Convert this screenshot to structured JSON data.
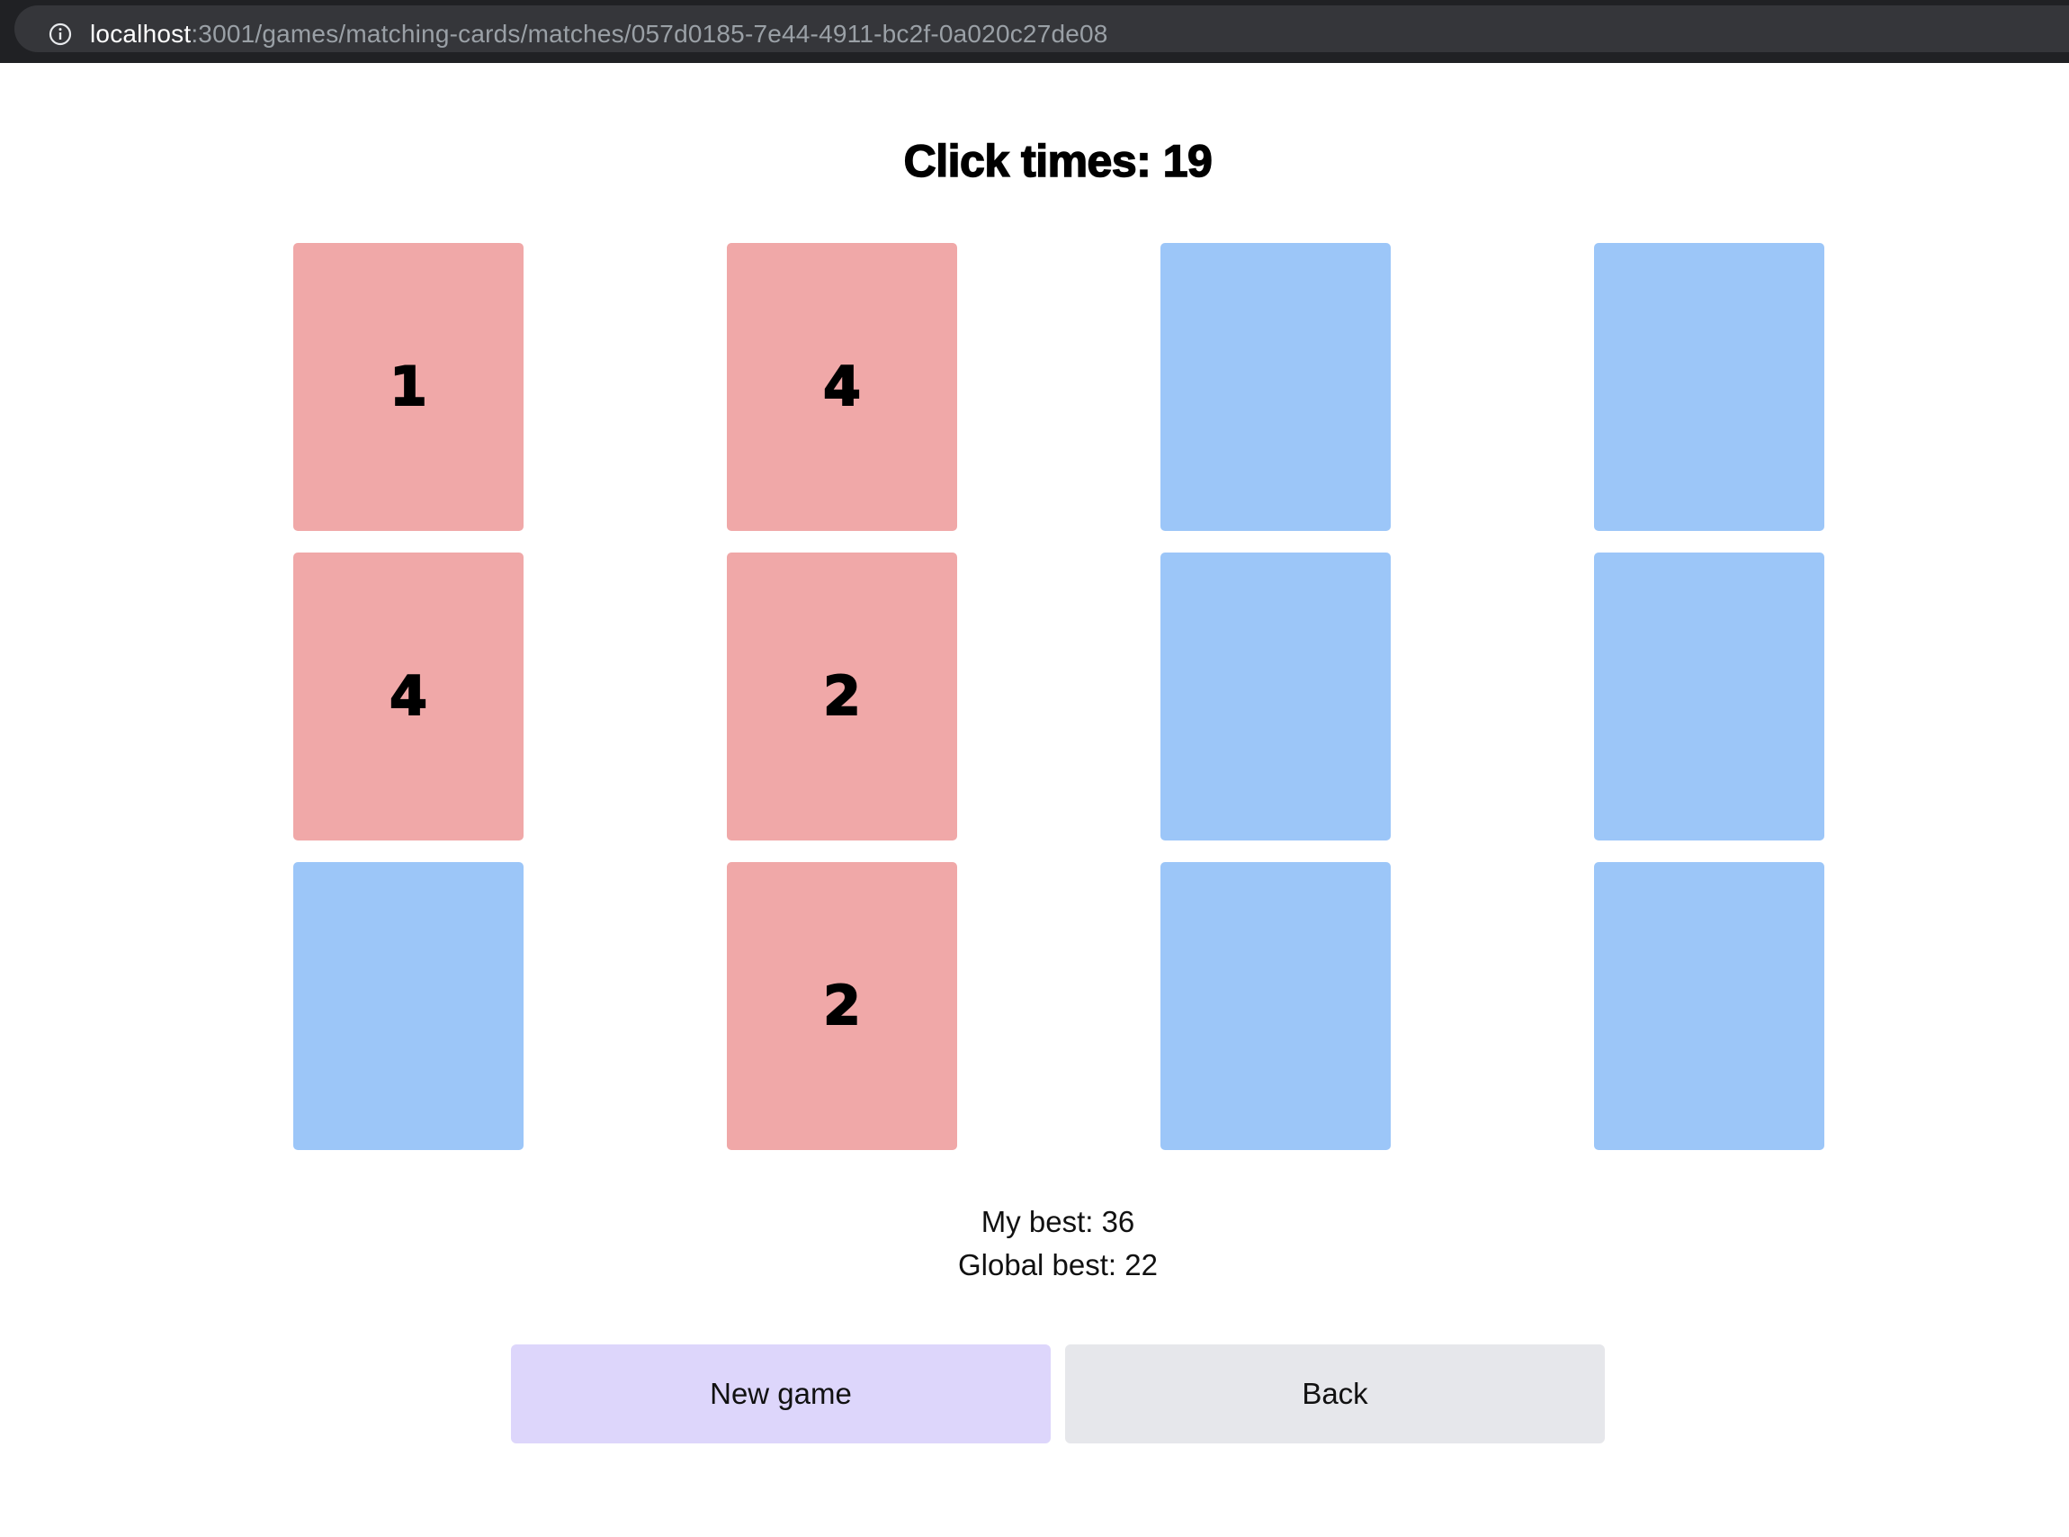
{
  "browser": {
    "url_host": "localhost",
    "url_path": ":3001/games/matching-cards/matches/057d0185-7e44-4911-bc2f-0a020c27de08"
  },
  "game": {
    "title": "Click times: 19",
    "cards": [
      {
        "value": "1",
        "state": "revealed"
      },
      {
        "value": "4",
        "state": "revealed"
      },
      {
        "value": "",
        "state": "hidden"
      },
      {
        "value": "",
        "state": "hidden"
      },
      {
        "value": "4",
        "state": "revealed"
      },
      {
        "value": "2",
        "state": "revealed"
      },
      {
        "value": "",
        "state": "hidden"
      },
      {
        "value": "",
        "state": "hidden"
      },
      {
        "value": "",
        "state": "hidden"
      },
      {
        "value": "2",
        "state": "revealed"
      },
      {
        "value": "",
        "state": "hidden"
      },
      {
        "value": "",
        "state": "hidden"
      }
    ],
    "my_best": "My best: 36",
    "global_best": "Global best: 22"
  },
  "actions": {
    "new_game_label": "New game",
    "back_label": "Back"
  },
  "colors": {
    "revealed": "#f0a8a8",
    "hidden": "#9cc6f8",
    "new_game_bg": "#ddd6fb",
    "back_bg": "#e6e7eb"
  }
}
